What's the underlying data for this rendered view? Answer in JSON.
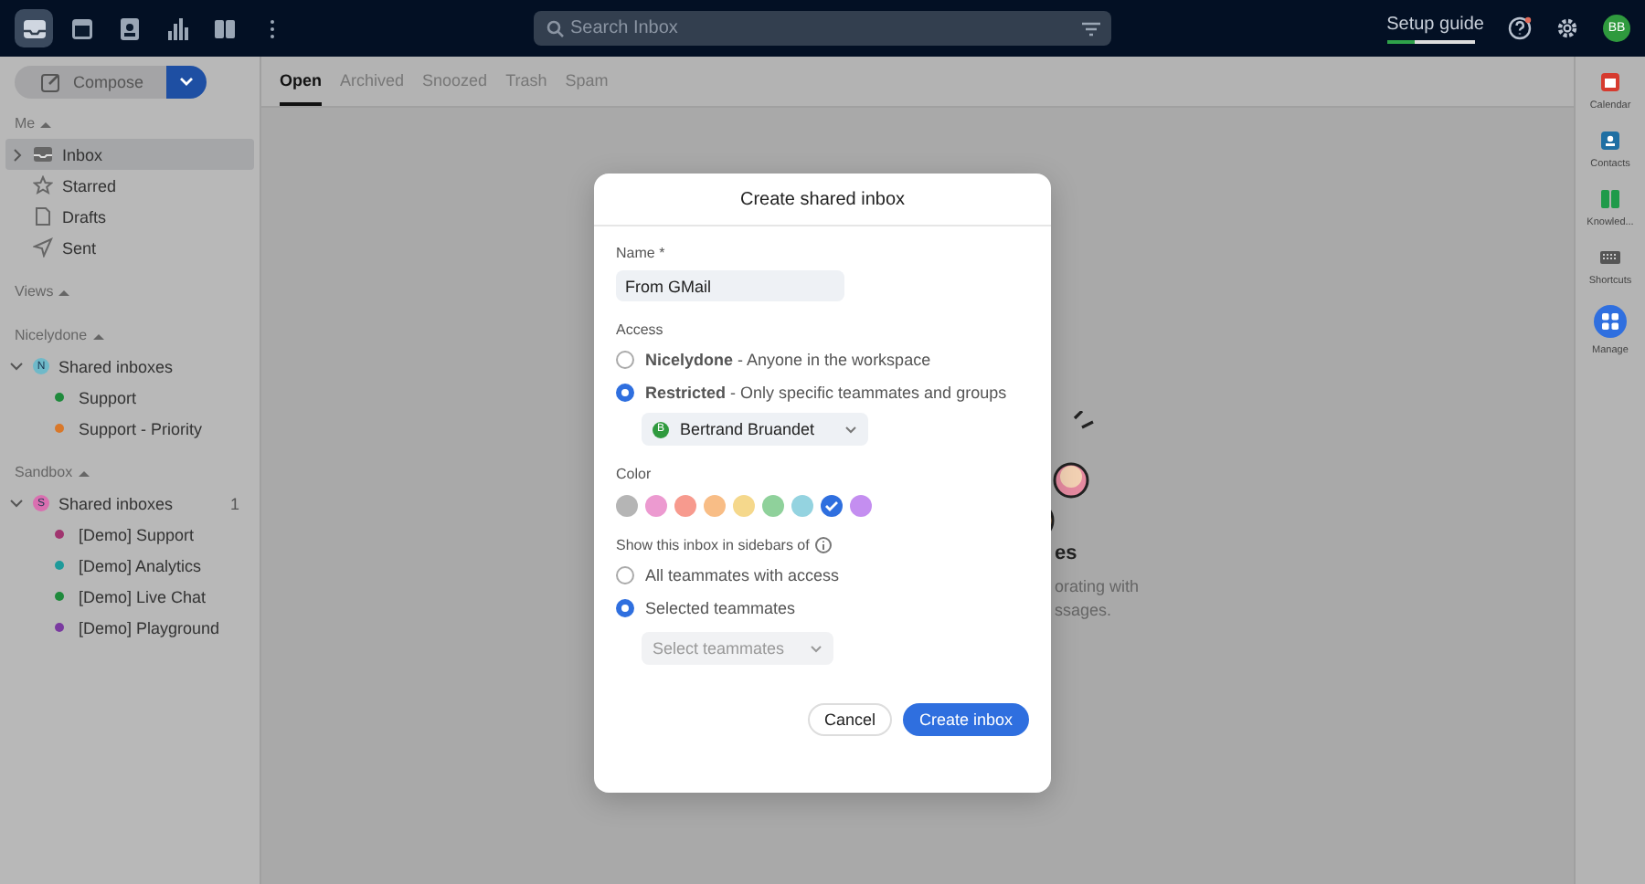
{
  "topbar": {
    "app_icons": [
      {
        "selected": true
      },
      {
        "selected": false
      },
      {
        "selected": false
      },
      {
        "selected": false
      },
      {
        "selected": false
      },
      {
        "selected": false
      }
    ],
    "search": {
      "placeholder": "Search Inbox"
    },
    "setup_guide": {
      "label": "Setup guide",
      "level": 0.33
    },
    "avatar": {
      "initials": "BB"
    }
  },
  "compose": {
    "label": "Compose"
  },
  "tabs": [
    {
      "label": "Open",
      "selected": true
    },
    {
      "label": "Archived",
      "selected": false
    },
    {
      "label": "Snoozed",
      "selected": false
    },
    {
      "label": "Trash",
      "selected": false
    },
    {
      "label": "Spam",
      "selected": false
    }
  ],
  "sidebar": [
    {
      "heading": "Me",
      "items": [
        {
          "label": "Inbox",
          "selected": true
        },
        {
          "label": "Starred",
          "selected": false
        },
        {
          "label": "Drafts",
          "selected": false
        },
        {
          "label": "Sent",
          "selected": false
        }
      ]
    },
    {
      "heading": "Views"
    },
    {
      "heading": "Nicelydone",
      "groups": [
        {
          "label": "Shared inboxes",
          "badge": "N",
          "color": "#6fb9c9",
          "expanded": true,
          "children": [
            {
              "label": "Support",
              "color": "#1f8a3c"
            },
            {
              "label": "Support - Priority",
              "color": "#d9782a"
            }
          ]
        }
      ]
    },
    {
      "heading": "Sandbox",
      "groups": [
        {
          "label": "Shared inboxes",
          "badge": "S",
          "color": "#d96fb0",
          "count": "1",
          "expanded": true,
          "children": [
            {
              "label": "[Demo] Support",
              "color": "#a0356f"
            },
            {
              "label": "[Demo] Analytics",
              "color": "#1e9a9a"
            },
            {
              "label": "[Demo] Live Chat",
              "color": "#1f8a3c"
            },
            {
              "label": "[Demo] Playground",
              "color": "#7a3aa0"
            }
          ]
        }
      ]
    }
  ],
  "empty_state": {
    "heading": "es",
    "lines": [
      "orating with",
      "ssages."
    ]
  },
  "right_rail": [
    {
      "label": "Calendar"
    },
    {
      "label": "Contacts"
    },
    {
      "label": "Knowled..."
    },
    {
      "label": "Shortcuts"
    },
    {
      "label": "Manage"
    }
  ],
  "modal": {
    "title": "Create shared inbox",
    "name_label": "Name *",
    "name_value": "From GMail",
    "access_label": "Access",
    "access_options": [
      {
        "text": "**Nicelydone** - Anyone in the workspace",
        "selected": false
      },
      {
        "text": "**Restricted** - Only specific teammates and groups",
        "selected": true
      }
    ],
    "member": {
      "initial": "B",
      "name": "Bertrand Bruandet"
    },
    "color_label": "Color",
    "colors": [
      {
        "color": "#b5b5b5",
        "selected": false
      },
      {
        "color": "#ec9ad0",
        "selected": false
      },
      {
        "color": "#f79a8e",
        "selected": false
      },
      {
        "color": "#f8bd86",
        "selected": false
      },
      {
        "color": "#f5d88c",
        "selected": false
      },
      {
        "color": "#8fd19b",
        "selected": false
      },
      {
        "color": "#94d3e0",
        "selected": false
      },
      {
        "color": "#2f6fdf",
        "selected": true
      },
      {
        "color": "#c48ef0",
        "selected": false
      }
    ],
    "sidebar_label": "Show this inbox in sidebars of",
    "sidebar_options": [
      {
        "text": "All teammates with access",
        "selected": false
      },
      {
        "text": "Selected teammates",
        "selected": true
      }
    ],
    "teammates_select": {
      "placeholder": "Select teammates"
    },
    "buttons": [
      {
        "label": "Cancel",
        "kind": "secondary"
      },
      {
        "label": "Create inbox",
        "kind": "primary"
      }
    ]
  }
}
